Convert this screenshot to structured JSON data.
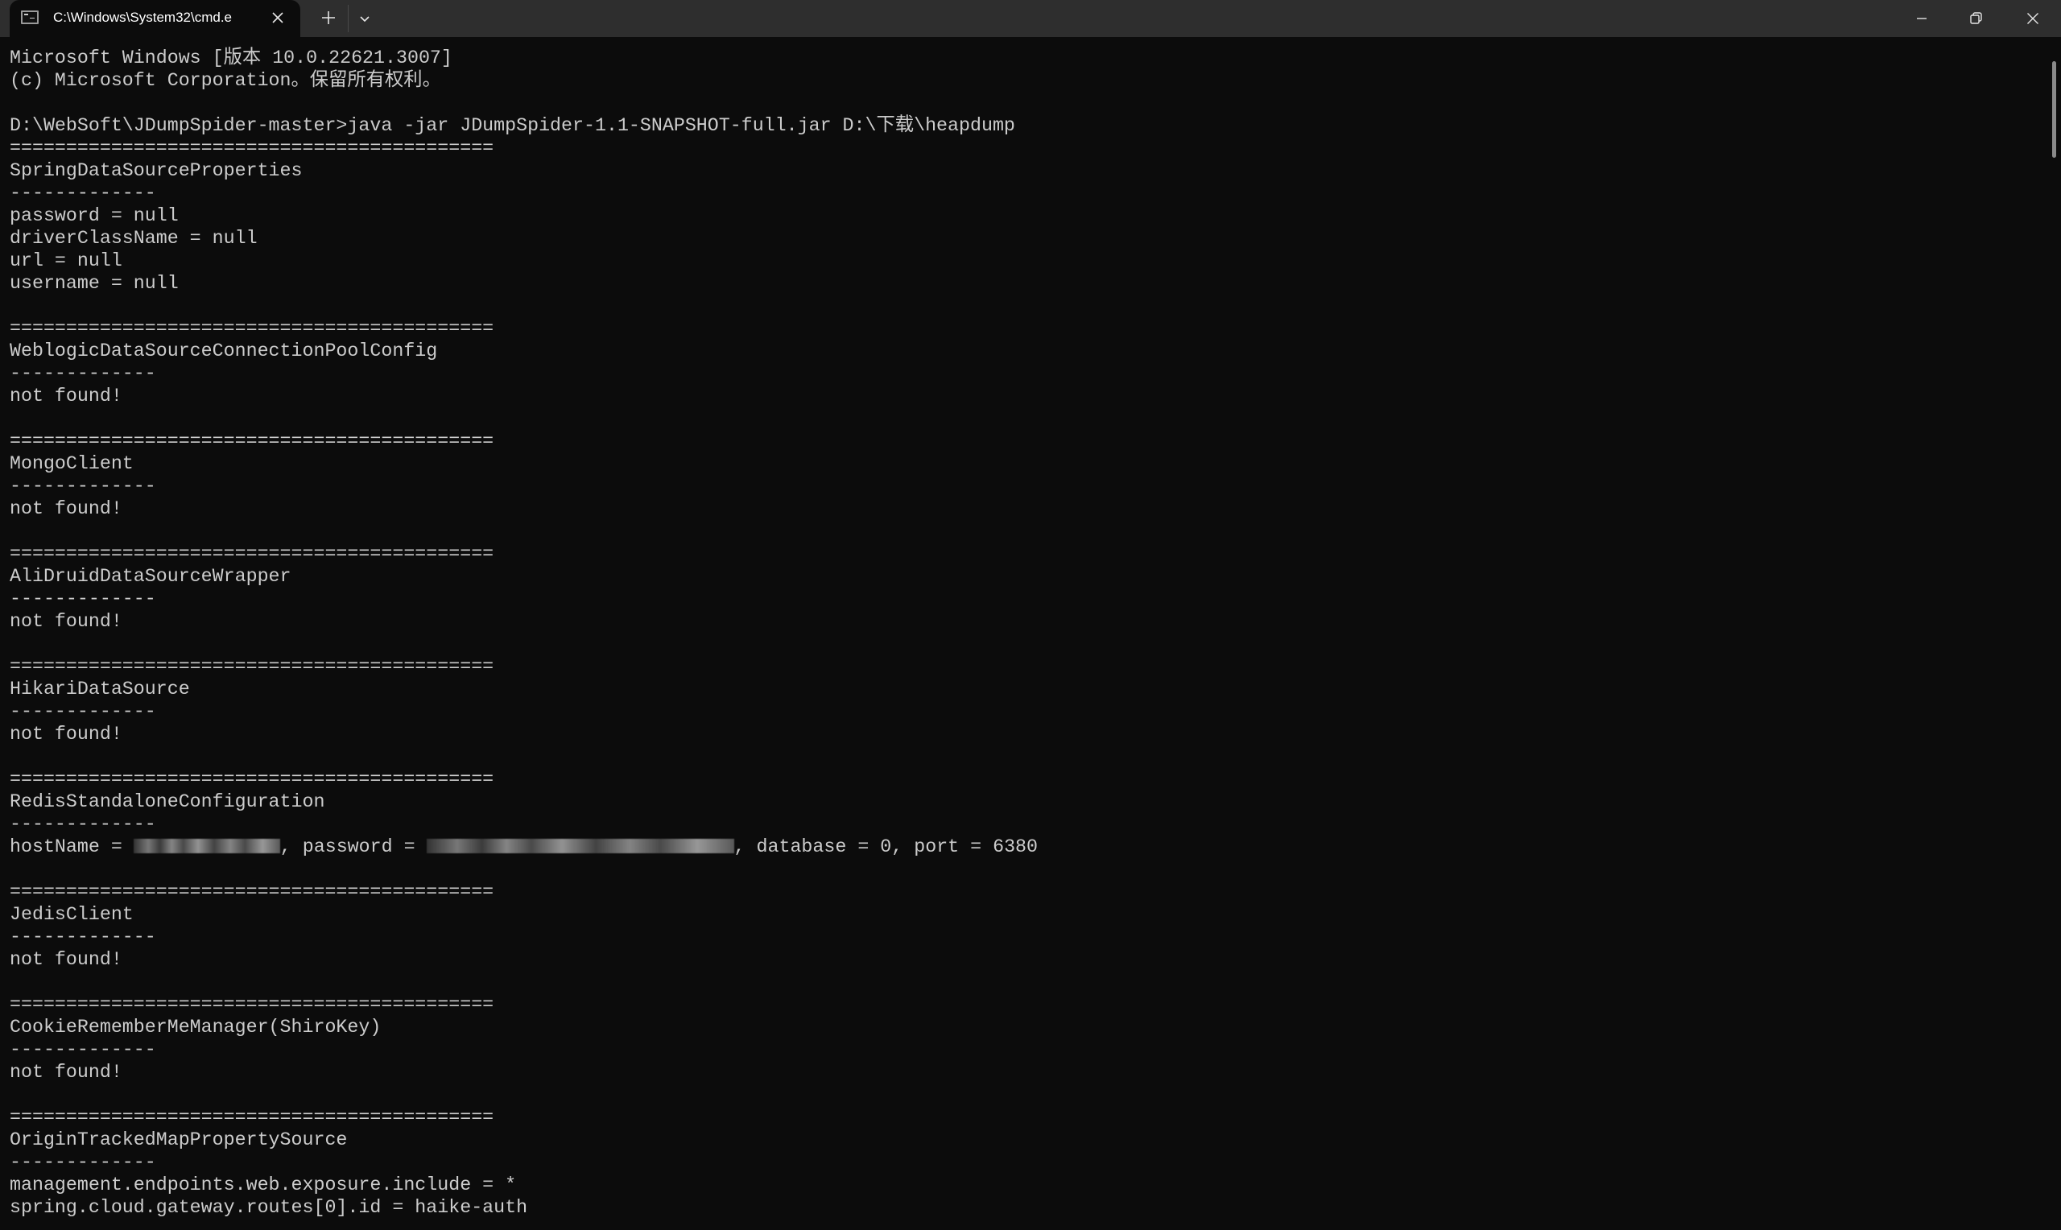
{
  "window": {
    "tab_title": "C:\\Windows\\System32\\cmd.e",
    "tab_icon": "terminal-icon",
    "close_tab_icon": "close-icon",
    "new_tab_icon": "plus-icon",
    "dropdown_icon": "chevron-down-icon",
    "controls": {
      "minimize": "minimize-icon",
      "restore": "restore-icon",
      "close": "close-icon"
    }
  },
  "terminal": {
    "lines": [
      "Microsoft Windows [版本 10.0.22621.3007]",
      "(c) Microsoft Corporation。保留所有权利。",
      "",
      "D:\\WebSoft\\JDumpSpider-master>java -jar JDumpSpider-1.1-SNAPSHOT-full.jar D:\\下载\\heapdump",
      "===========================================",
      "SpringDataSourceProperties",
      "-------------",
      "password = null",
      "driverClassName = null",
      "url = null",
      "username = null",
      "",
      "===========================================",
      "WeblogicDataSourceConnectionPoolConfig",
      "-------------",
      "not found!",
      "",
      "===========================================",
      "MongoClient",
      "-------------",
      "not found!",
      "",
      "===========================================",
      "AliDruidDataSourceWrapper",
      "-------------",
      "not found!",
      "",
      "===========================================",
      "HikariDataSource",
      "-------------",
      "not found!",
      "",
      "===========================================",
      "RedisStandaloneConfiguration",
      "-------------",
      "__REDIS__",
      "",
      "===========================================",
      "JedisClient",
      "-------------",
      "not found!",
      "",
      "===========================================",
      "CookieRememberMeManager(ShiroKey)",
      "-------------",
      "not found!",
      "",
      "===========================================",
      "OriginTrackedMapPropertySource",
      "-------------",
      "management.endpoints.web.exposure.include = *",
      "spring.cloud.gateway.routes[0].id = haike-auth"
    ],
    "redis_line": {
      "host_label": "hostName = ",
      "host_value": "[redacted]",
      "password_label": ", password = ",
      "password_value": "[redacted]",
      "rest": ", database = 0, port = 6380"
    }
  },
  "colors": {
    "terminal_bg": "#0c0c0c",
    "terminal_fg": "#cccccc",
    "titlebar_bg": "#2e2e2e"
  }
}
